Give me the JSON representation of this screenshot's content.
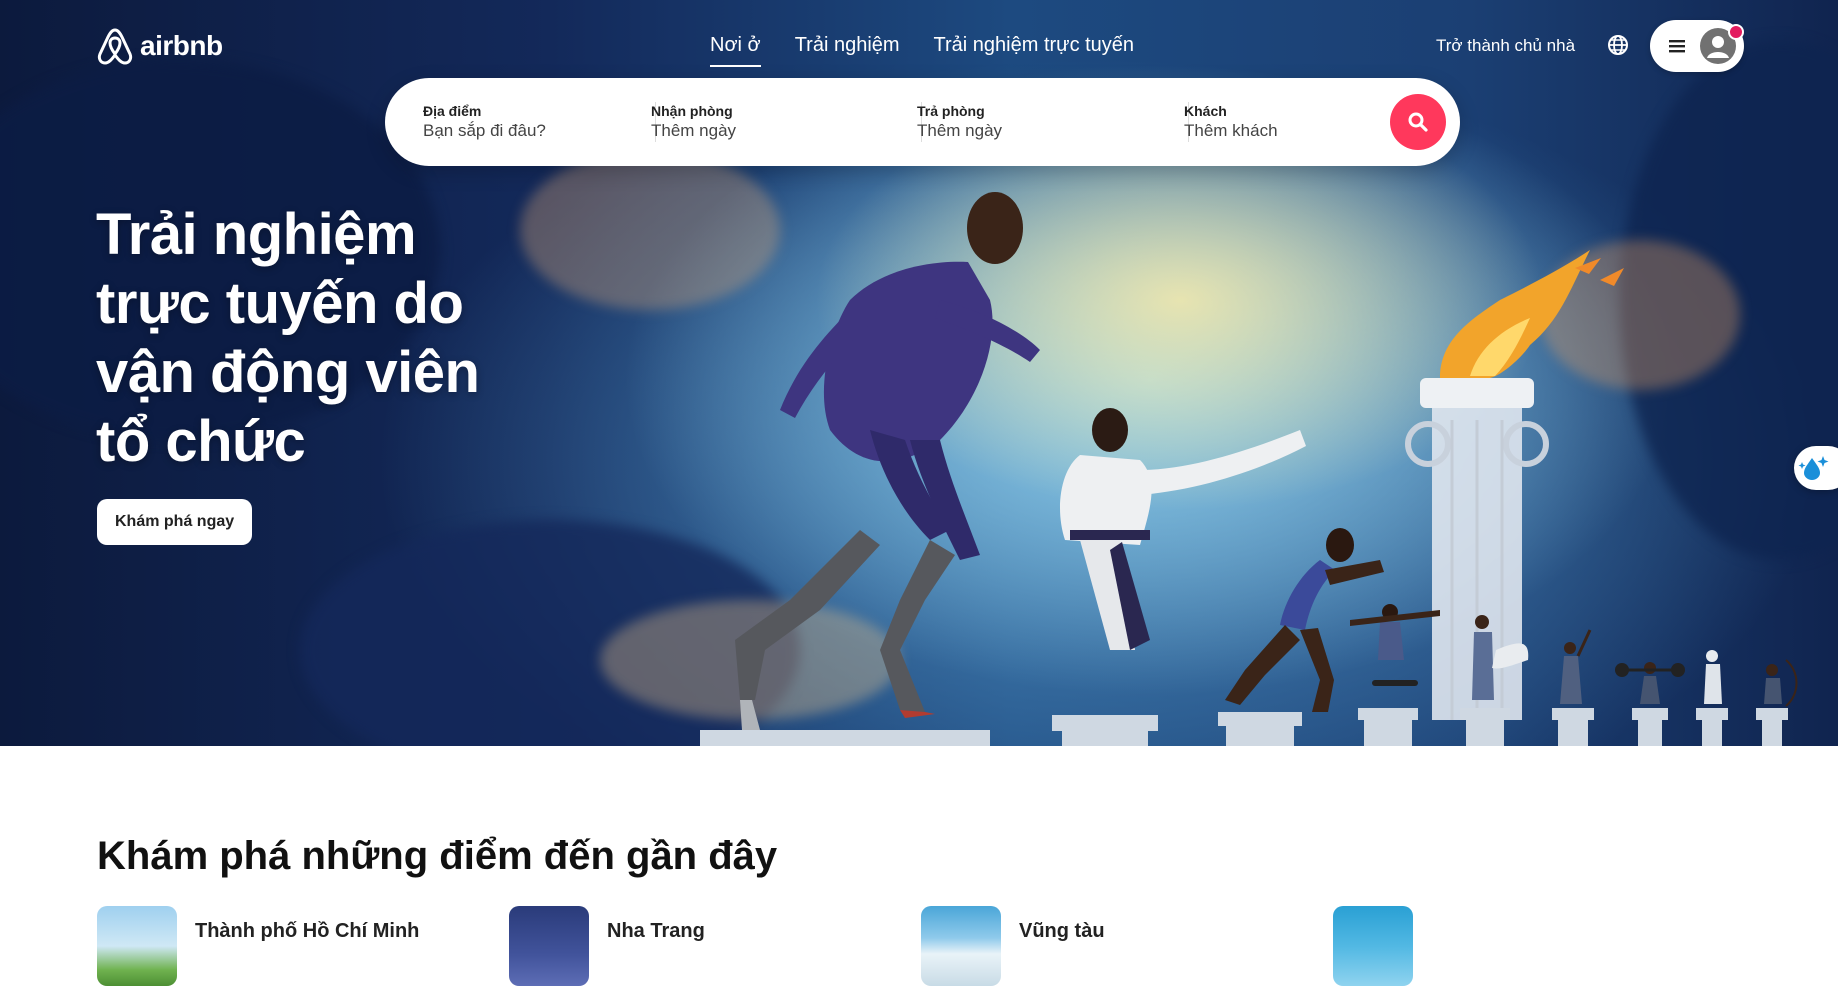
{
  "header": {
    "logo_text": "airbnb",
    "tabs": [
      {
        "label": "Nơi ở",
        "active": true
      },
      {
        "label": "Trải nghiệm",
        "active": false
      },
      {
        "label": "Trải nghiệm trực tuyến",
        "active": false
      }
    ],
    "host_link": "Trở thành chủ nhà"
  },
  "search": {
    "location_label": "Địa điểm",
    "location_placeholder": "Bạn sắp đi đâu?",
    "checkin_label": "Nhận phòng",
    "checkin_placeholder": "Thêm ngày",
    "checkout_label": "Trả phòng",
    "checkout_placeholder": "Thêm ngày",
    "guests_label": "Khách",
    "guests_placeholder": "Thêm khách"
  },
  "hero": {
    "title": "Trải nghiệm trực tuyến do vận động viên tổ chức",
    "cta_label": "Khám phá ngay"
  },
  "section": {
    "title": "Khám phá những điểm đến gần đây",
    "destinations": [
      {
        "name": "Thành phố Hồ Chí Minh"
      },
      {
        "name": "Nha Trang"
      },
      {
        "name": "Vũng tàu"
      },
      {
        "name": ""
      }
    ]
  },
  "colors": {
    "brand": "#ff385c",
    "hero_sky": "#1d4a80",
    "notification": "#e31c5f"
  }
}
